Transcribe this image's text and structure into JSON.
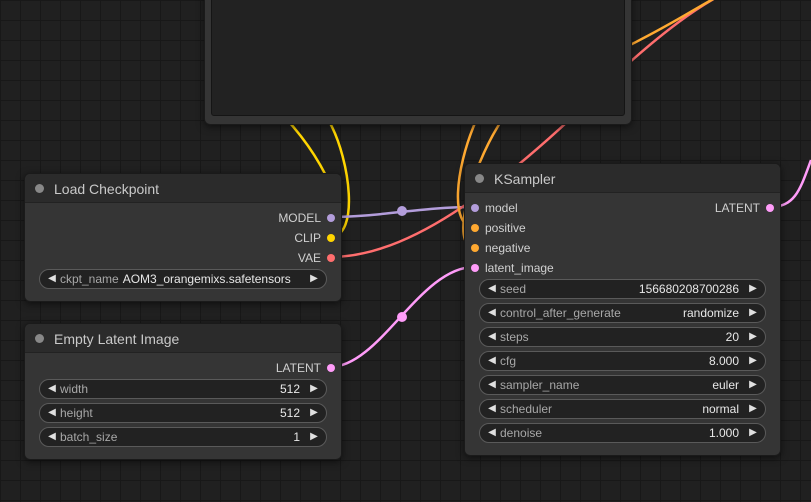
{
  "colors": {
    "model": "#b39ddb",
    "clip": "#ffd500",
    "vae": "#ff6e6e",
    "conditioning": "#ffa931",
    "latent": "#ff9cf9"
  },
  "load_checkpoint": {
    "title": "Load Checkpoint",
    "outputs": {
      "model": "MODEL",
      "clip": "CLIP",
      "vae": "VAE"
    },
    "ckpt": {
      "label": "ckpt_name",
      "value": "AOM3_orangemixs.safetensors"
    }
  },
  "empty_latent": {
    "title": "Empty Latent Image",
    "output": "LATENT",
    "widgets": [
      {
        "label": "width",
        "value": "512"
      },
      {
        "label": "height",
        "value": "512"
      },
      {
        "label": "batch_size",
        "value": "1"
      }
    ]
  },
  "ksampler": {
    "title": "KSampler",
    "inputs": {
      "model": "model",
      "positive": "positive",
      "negative": "negative",
      "latent": "latent_image"
    },
    "output": "LATENT",
    "widgets": [
      {
        "label": "seed",
        "value": "156680208700286"
      },
      {
        "label": "control_after_generate",
        "value": "randomize"
      },
      {
        "label": "steps",
        "value": "20"
      },
      {
        "label": "cfg",
        "value": "8.000"
      },
      {
        "label": "sampler_name",
        "value": "euler"
      },
      {
        "label": "scheduler",
        "value": "normal"
      },
      {
        "label": "denoise",
        "value": "1.000"
      }
    ]
  },
  "icons": {
    "left_arrow": "◀",
    "right_arrow": "▶"
  }
}
